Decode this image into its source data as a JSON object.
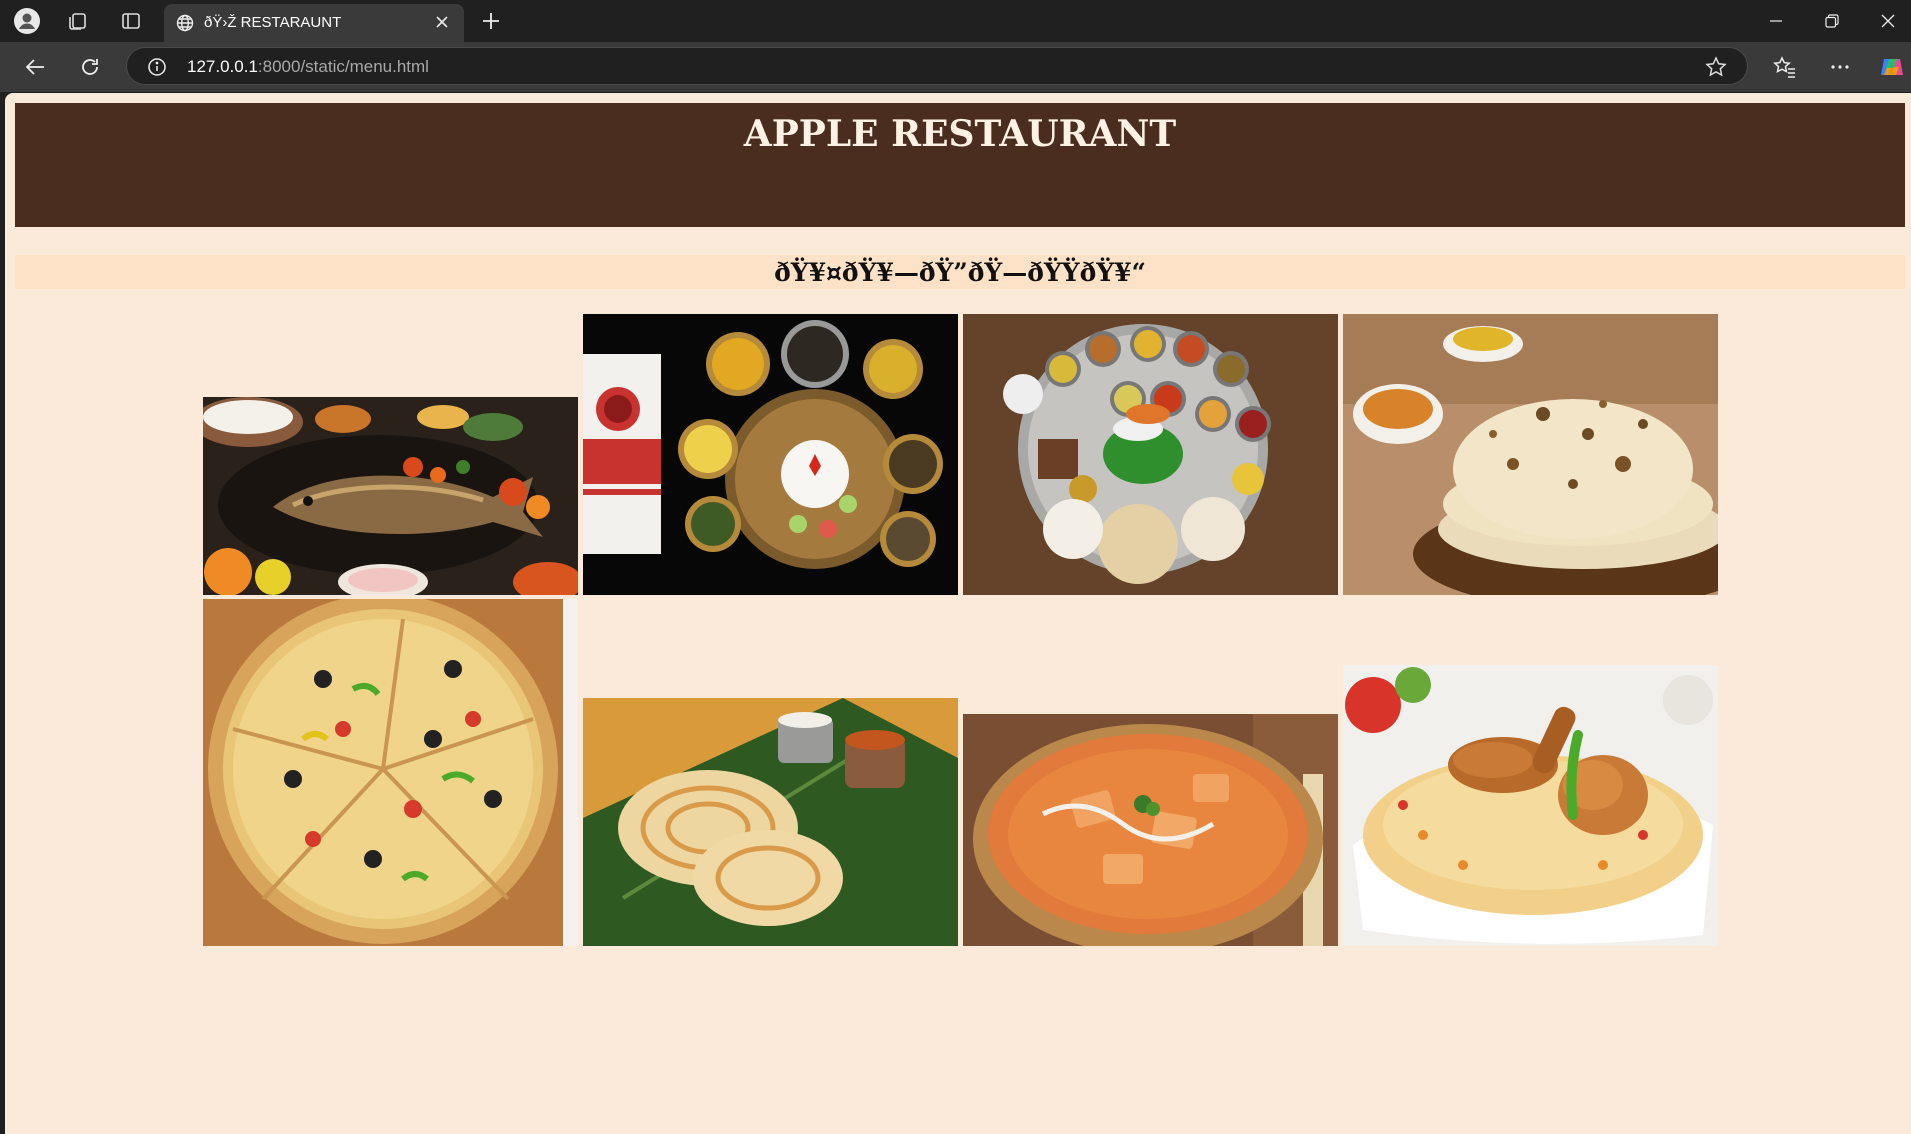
{
  "browser": {
    "tab_title": "ðŸ›Ž­ RESTARAUNT",
    "url_host": "127.0.0.1",
    "url_path": ":8000/static/menu.html"
  },
  "page": {
    "title": "APPLE RESTAURANT",
    "subtitle": "ðŸ¥¤ðŸ¥—ðŸ”ðŸ—ðŸŸðŸ¥“"
  },
  "colors": {
    "header_bg": "#4a2d1e",
    "page_bg": "#fbe9d9",
    "subheader_bg": "#fde2c7"
  },
  "menu_images": [
    {
      "name": "fish-platter-photo"
    },
    {
      "name": "assamese-thali-photo"
    },
    {
      "name": "veg-thali-photo"
    },
    {
      "name": "naan-stack-photo"
    },
    {
      "name": "pizza-photo"
    },
    {
      "name": "parotta-photo"
    },
    {
      "name": "paneer-curry-photo"
    },
    {
      "name": "chicken-biryani-photo"
    }
  ]
}
